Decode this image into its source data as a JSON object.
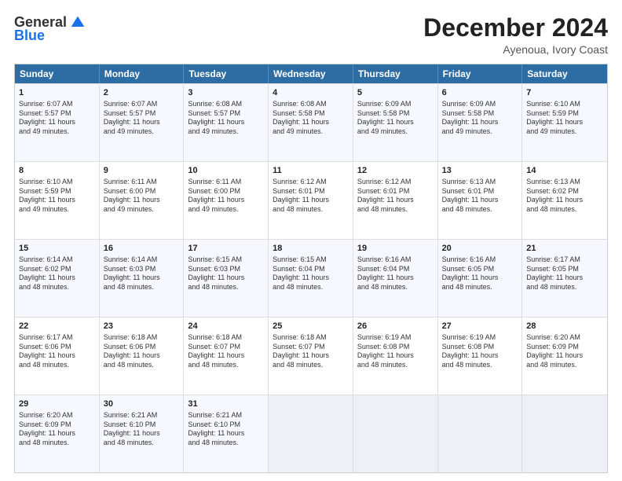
{
  "logo": {
    "general": "General",
    "blue": "Blue"
  },
  "header": {
    "month": "December 2024",
    "location": "Ayenoua, Ivory Coast"
  },
  "weekdays": [
    "Sunday",
    "Monday",
    "Tuesday",
    "Wednesday",
    "Thursday",
    "Friday",
    "Saturday"
  ],
  "weeks": [
    [
      {
        "day": "1",
        "info": "Sunrise: 6:07 AM\nSunset: 5:57 PM\nDaylight: 11 hours\nand 49 minutes."
      },
      {
        "day": "2",
        "info": "Sunrise: 6:07 AM\nSunset: 5:57 PM\nDaylight: 11 hours\nand 49 minutes."
      },
      {
        "day": "3",
        "info": "Sunrise: 6:08 AM\nSunset: 5:57 PM\nDaylight: 11 hours\nand 49 minutes."
      },
      {
        "day": "4",
        "info": "Sunrise: 6:08 AM\nSunset: 5:58 PM\nDaylight: 11 hours\nand 49 minutes."
      },
      {
        "day": "5",
        "info": "Sunrise: 6:09 AM\nSunset: 5:58 PM\nDaylight: 11 hours\nand 49 minutes."
      },
      {
        "day": "6",
        "info": "Sunrise: 6:09 AM\nSunset: 5:58 PM\nDaylight: 11 hours\nand 49 minutes."
      },
      {
        "day": "7",
        "info": "Sunrise: 6:10 AM\nSunset: 5:59 PM\nDaylight: 11 hours\nand 49 minutes."
      }
    ],
    [
      {
        "day": "8",
        "info": "Sunrise: 6:10 AM\nSunset: 5:59 PM\nDaylight: 11 hours\nand 49 minutes."
      },
      {
        "day": "9",
        "info": "Sunrise: 6:11 AM\nSunset: 6:00 PM\nDaylight: 11 hours\nand 49 minutes."
      },
      {
        "day": "10",
        "info": "Sunrise: 6:11 AM\nSunset: 6:00 PM\nDaylight: 11 hours\nand 49 minutes."
      },
      {
        "day": "11",
        "info": "Sunrise: 6:12 AM\nSunset: 6:01 PM\nDaylight: 11 hours\nand 48 minutes."
      },
      {
        "day": "12",
        "info": "Sunrise: 6:12 AM\nSunset: 6:01 PM\nDaylight: 11 hours\nand 48 minutes."
      },
      {
        "day": "13",
        "info": "Sunrise: 6:13 AM\nSunset: 6:01 PM\nDaylight: 11 hours\nand 48 minutes."
      },
      {
        "day": "14",
        "info": "Sunrise: 6:13 AM\nSunset: 6:02 PM\nDaylight: 11 hours\nand 48 minutes."
      }
    ],
    [
      {
        "day": "15",
        "info": "Sunrise: 6:14 AM\nSunset: 6:02 PM\nDaylight: 11 hours\nand 48 minutes."
      },
      {
        "day": "16",
        "info": "Sunrise: 6:14 AM\nSunset: 6:03 PM\nDaylight: 11 hours\nand 48 minutes."
      },
      {
        "day": "17",
        "info": "Sunrise: 6:15 AM\nSunset: 6:03 PM\nDaylight: 11 hours\nand 48 minutes."
      },
      {
        "day": "18",
        "info": "Sunrise: 6:15 AM\nSunset: 6:04 PM\nDaylight: 11 hours\nand 48 minutes."
      },
      {
        "day": "19",
        "info": "Sunrise: 6:16 AM\nSunset: 6:04 PM\nDaylight: 11 hours\nand 48 minutes."
      },
      {
        "day": "20",
        "info": "Sunrise: 6:16 AM\nSunset: 6:05 PM\nDaylight: 11 hours\nand 48 minutes."
      },
      {
        "day": "21",
        "info": "Sunrise: 6:17 AM\nSunset: 6:05 PM\nDaylight: 11 hours\nand 48 minutes."
      }
    ],
    [
      {
        "day": "22",
        "info": "Sunrise: 6:17 AM\nSunset: 6:06 PM\nDaylight: 11 hours\nand 48 minutes."
      },
      {
        "day": "23",
        "info": "Sunrise: 6:18 AM\nSunset: 6:06 PM\nDaylight: 11 hours\nand 48 minutes."
      },
      {
        "day": "24",
        "info": "Sunrise: 6:18 AM\nSunset: 6:07 PM\nDaylight: 11 hours\nand 48 minutes."
      },
      {
        "day": "25",
        "info": "Sunrise: 6:18 AM\nSunset: 6:07 PM\nDaylight: 11 hours\nand 48 minutes."
      },
      {
        "day": "26",
        "info": "Sunrise: 6:19 AM\nSunset: 6:08 PM\nDaylight: 11 hours\nand 48 minutes."
      },
      {
        "day": "27",
        "info": "Sunrise: 6:19 AM\nSunset: 6:08 PM\nDaylight: 11 hours\nand 48 minutes."
      },
      {
        "day": "28",
        "info": "Sunrise: 6:20 AM\nSunset: 6:09 PM\nDaylight: 11 hours\nand 48 minutes."
      }
    ],
    [
      {
        "day": "29",
        "info": "Sunrise: 6:20 AM\nSunset: 6:09 PM\nDaylight: 11 hours\nand 48 minutes."
      },
      {
        "day": "30",
        "info": "Sunrise: 6:21 AM\nSunset: 6:10 PM\nDaylight: 11 hours\nand 48 minutes."
      },
      {
        "day": "31",
        "info": "Sunrise: 6:21 AM\nSunset: 6:10 PM\nDaylight: 11 hours\nand 48 minutes."
      },
      null,
      null,
      null,
      null
    ]
  ]
}
